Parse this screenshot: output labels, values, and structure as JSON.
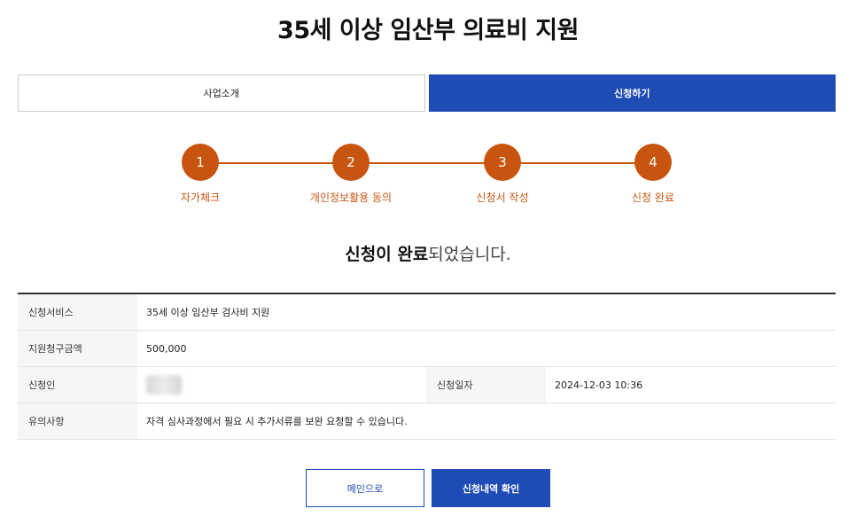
{
  "page": {
    "title": "35세 이상 임산부 의료비 지원"
  },
  "tabs": [
    {
      "label": "사업소개",
      "active": false
    },
    {
      "label": "신청하기",
      "active": true
    }
  ],
  "steps": [
    {
      "number": "1",
      "label": "자가체크"
    },
    {
      "number": "2",
      "label": "개인정보활용 동의"
    },
    {
      "number": "3",
      "label": "신청서 작성"
    },
    {
      "number": "4",
      "label": "신청 완료"
    }
  ],
  "message": {
    "strong": "신청이 완료",
    "rest": "되었습니다."
  },
  "info": {
    "service_label": "신청서비스",
    "service_value": "35세 이상 임산부 검사비 지원",
    "amount_label": "지원청구금액",
    "amount_value": "500,000",
    "applicant_label": "신청인",
    "date_label": "신청일자",
    "date_value": "2024-12-03 10:36",
    "notice_label": "유의사항",
    "notice_value": "자격 심사과정에서 필요 시 추가서류를 보완 요청할 수 있습니다."
  },
  "buttons": {
    "main": "메인으로",
    "history": "신청내역 확인"
  },
  "colors": {
    "accent_blue": "#1f4bb5",
    "step_orange": "#c8550f"
  }
}
